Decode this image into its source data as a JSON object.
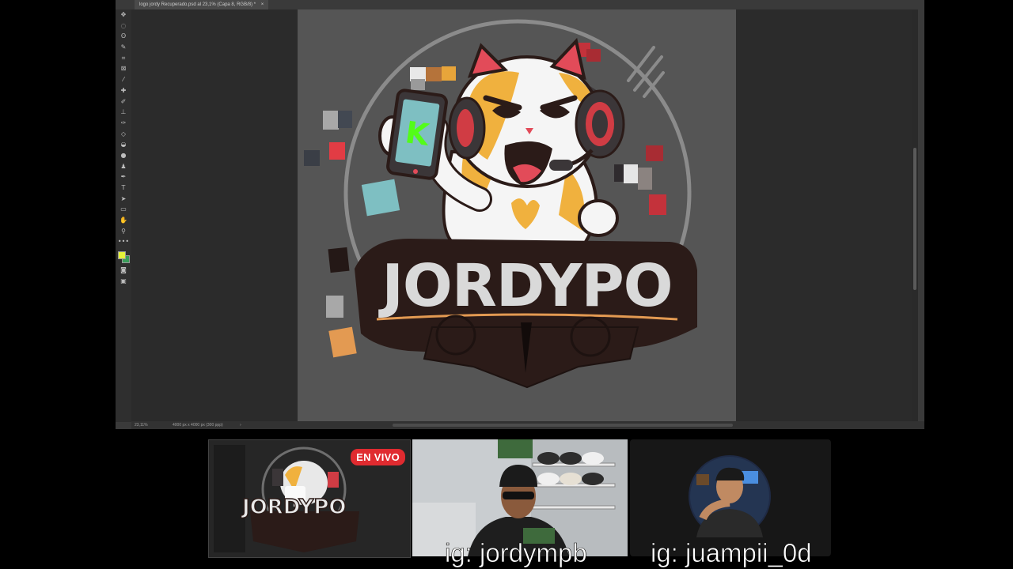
{
  "document": {
    "tab_title": "logo jordy Recuperado.psd al 23,1% (Capa 8, RGB/8) *",
    "tab_close": "×",
    "zoom_status": "23,11%",
    "size_status": "4000 px x 4000 px (300 ppp)",
    "status_arrow": "›"
  },
  "toolbar": {
    "tools": [
      {
        "name": "move-tool-icon",
        "glyph": "✥"
      },
      {
        "name": "marquee-tool-icon",
        "glyph": "◌"
      },
      {
        "name": "lasso-tool-icon",
        "glyph": "ʘ"
      },
      {
        "name": "magic-wand-tool-icon",
        "glyph": "✎"
      },
      {
        "name": "crop-tool-icon",
        "glyph": "⌗"
      },
      {
        "name": "frame-tool-icon",
        "glyph": "⊠"
      },
      {
        "name": "eyedropper-tool-icon",
        "glyph": "⁄"
      },
      {
        "name": "healing-brush-tool-icon",
        "glyph": "✚"
      },
      {
        "name": "brush-tool-icon",
        "glyph": "✐"
      },
      {
        "name": "stamp-tool-icon",
        "glyph": "⊥"
      },
      {
        "name": "history-brush-tool-icon",
        "glyph": "✑"
      },
      {
        "name": "eraser-tool-icon",
        "glyph": "◇"
      },
      {
        "name": "paint-bucket-tool-icon",
        "glyph": "◒"
      },
      {
        "name": "blur-tool-icon",
        "glyph": "●"
      },
      {
        "name": "dodge-tool-icon",
        "glyph": "♟"
      },
      {
        "name": "pen-tool-icon",
        "glyph": "✒"
      },
      {
        "name": "type-tool-icon",
        "glyph": "T"
      },
      {
        "name": "path-selection-tool-icon",
        "glyph": "➤"
      },
      {
        "name": "rectangle-tool-icon",
        "glyph": "▭"
      },
      {
        "name": "hand-tool-icon",
        "glyph": "✋"
      },
      {
        "name": "zoom-tool-icon",
        "glyph": "⚲"
      },
      {
        "name": "more-tools-icon",
        "glyph": "•••"
      }
    ],
    "bottom_tools": [
      {
        "name": "quick-mask-icon",
        "glyph": "◙"
      },
      {
        "name": "screen-mode-icon",
        "glyph": "▣"
      }
    ],
    "foreground_color": "#e6f33a",
    "background_color": "#3a9d5a"
  },
  "artwork": {
    "logo_text": "JORDYPO",
    "phone_letter": "K"
  },
  "stream": {
    "live_badge": "EN VIVO",
    "tile1_logo_text": "JORDYPO",
    "captions": [
      {
        "text": "ig: jordympb"
      },
      {
        "text": "ig: juampii_0d"
      }
    ]
  },
  "colors": {
    "canvas_gray": "#555555",
    "live_red": "#e02b30",
    "logo_dark": "#2b1b18",
    "cat_orange": "#f0b13e",
    "kick_green": "#53fc18"
  }
}
